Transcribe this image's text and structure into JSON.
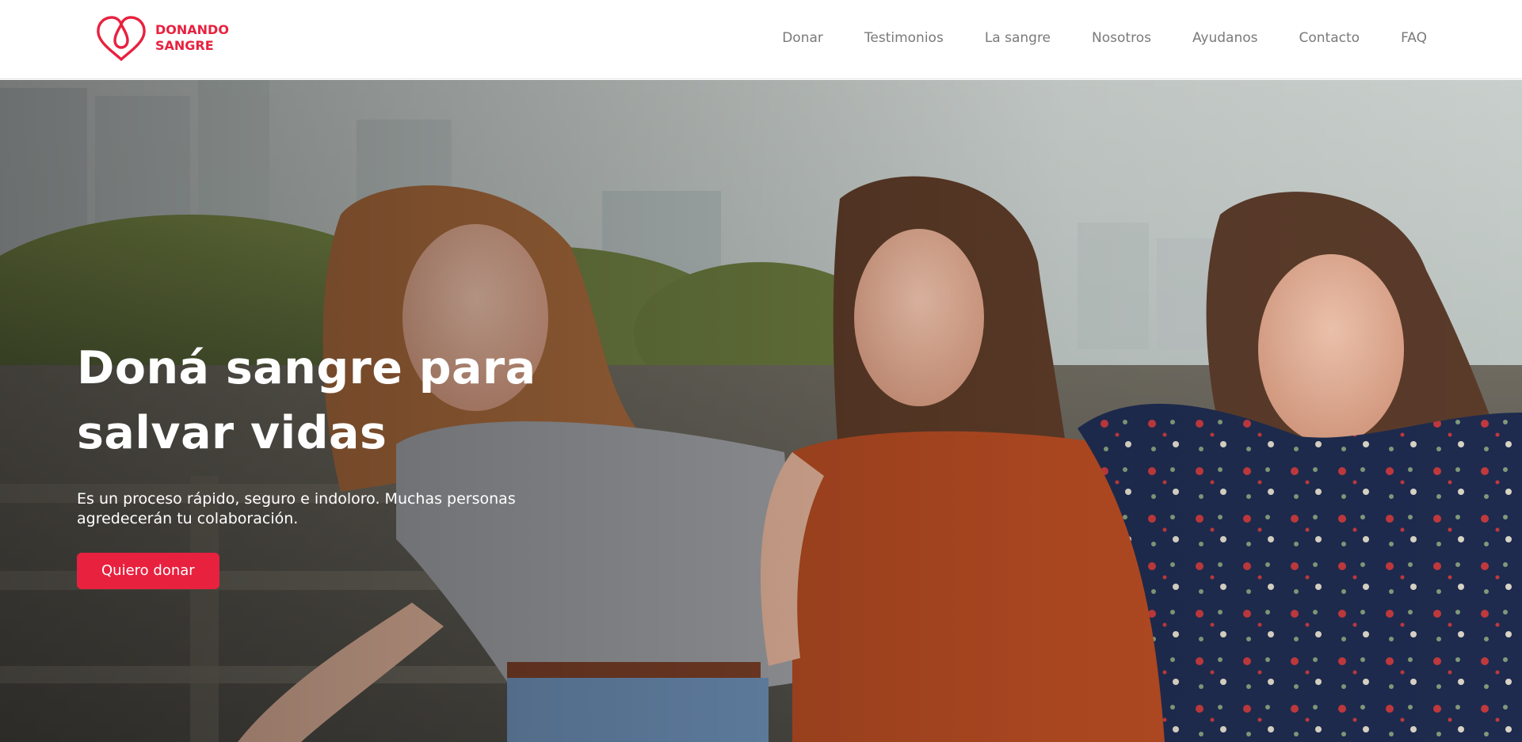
{
  "brand": {
    "line1": "DONANDO",
    "line2": "SANGRE",
    "icon": "heart-drop-icon",
    "color": "#e8213f"
  },
  "nav": {
    "items": [
      {
        "label": "Donar"
      },
      {
        "label": "Testimonios"
      },
      {
        "label": "La sangre"
      },
      {
        "label": "Nosotros"
      },
      {
        "label": "Ayudanos"
      },
      {
        "label": "Contacto"
      },
      {
        "label": "FAQ"
      }
    ],
    "color": "#7a7a7a"
  },
  "hero": {
    "title": "Doná sangre para salvar vidas",
    "subtitle": "Es un proceso rápido, seguro e indoloro. Muchas personas agredecerán tu colaboración.",
    "cta_label": "Quiero donar",
    "cta_color": "#e8213f",
    "image": "three-women-laughing-photo"
  }
}
